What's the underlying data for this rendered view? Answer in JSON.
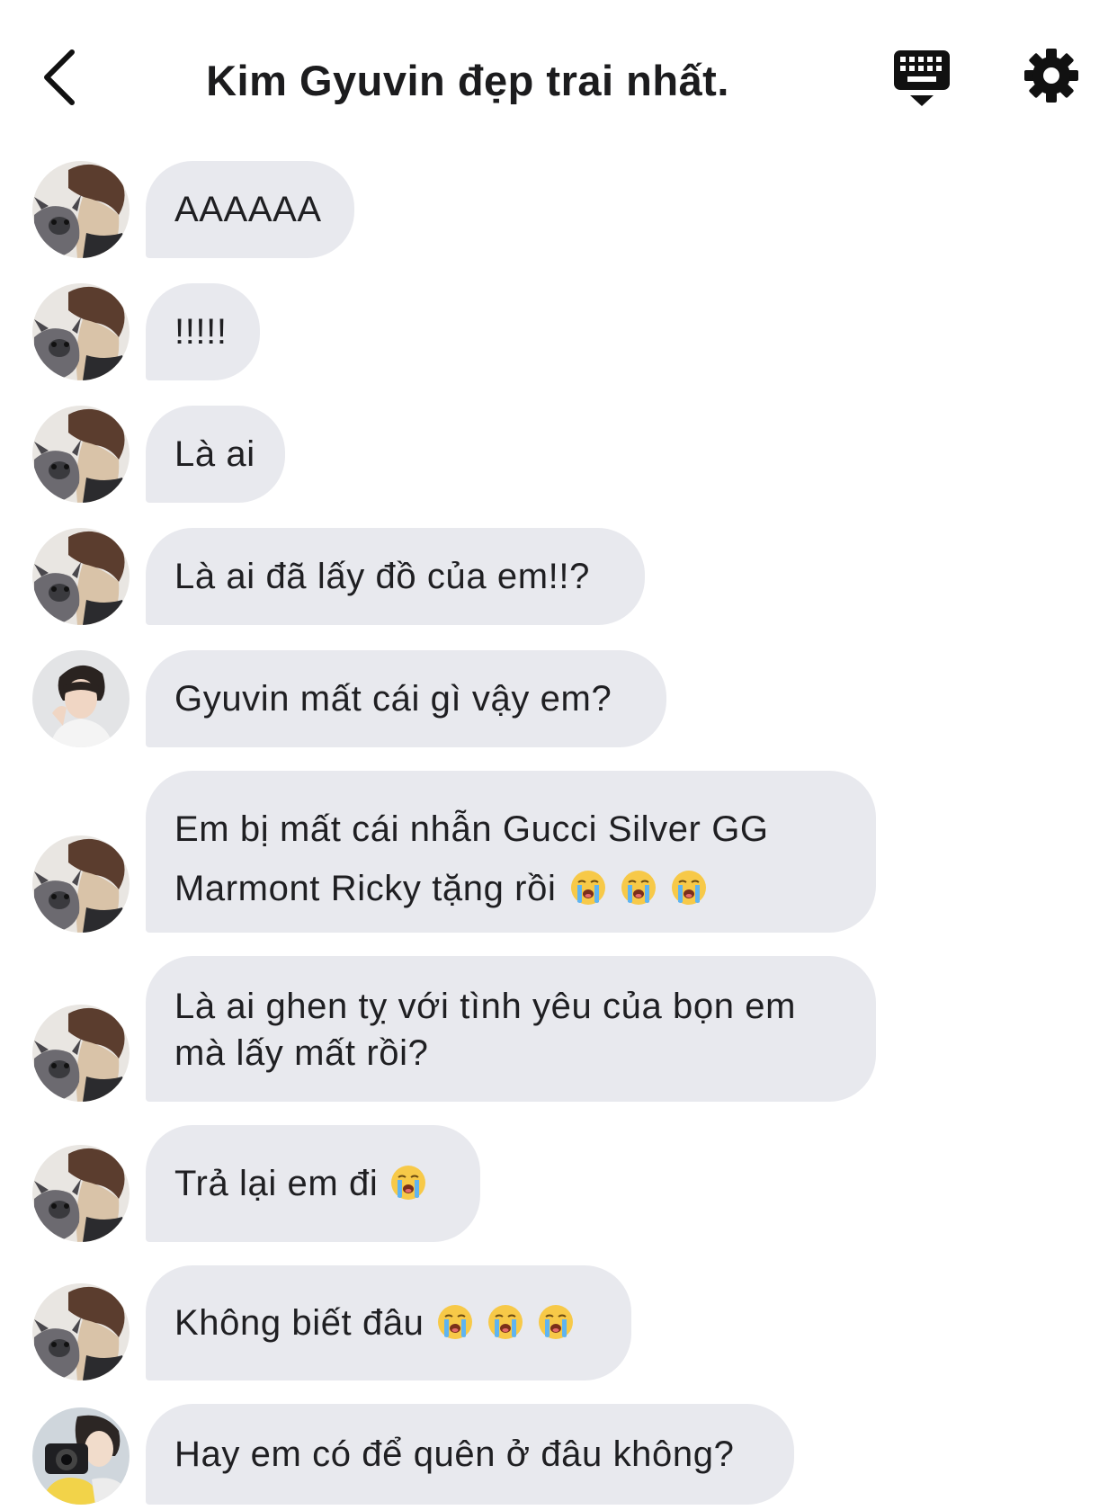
{
  "header": {
    "title": "Kim Gyuvin đẹp trai nhất."
  },
  "messages": [
    {
      "text": "AAAAAA",
      "sender": "puppy"
    },
    {
      "text": "!!!!!",
      "sender": "puppy"
    },
    {
      "text": "Là ai",
      "sender": "puppy"
    },
    {
      "text": "Là ai đã lấy đồ của em!!?",
      "sender": "puppy"
    },
    {
      "text": "Gyuvin mất cái gì vậy em?",
      "sender": "boy"
    },
    {
      "line1": "Em bị mất cái nhẫn Gucci Silver GG",
      "line2": "Marmont Ricky tặng rồi",
      "emoji": "loudly-crying-face",
      "emoji_count": 3,
      "sender": "puppy"
    },
    {
      "line1": "Là ai ghen tỵ với tình yêu của bọn em",
      "line2": "mà lấy mất rồi?",
      "sender": "puppy"
    },
    {
      "text": "Trả lại em đi",
      "emoji": "loudly-crying-face",
      "emoji_count": 1,
      "sender": "puppy"
    },
    {
      "text": "Không biết đâu",
      "emoji": "loudly-crying-face",
      "emoji_count": 3,
      "sender": "puppy"
    },
    {
      "text": "Hay em có để quên ở đâu không?",
      "sender": "camera"
    }
  ],
  "colors": {
    "bubble": "#e8e9ee",
    "text": "#1f1f22",
    "icon": "#111111"
  }
}
